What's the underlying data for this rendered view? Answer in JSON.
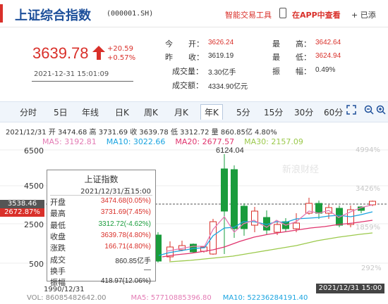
{
  "header": {
    "title": "上证综合指数",
    "code": "(000001.SH)",
    "tool_link": "智能交易工具",
    "app_link": "在APP中查看",
    "added": "+ 已添"
  },
  "quote": {
    "price": "3639.78",
    "change": "+20.59",
    "change_pct": "+0.57%",
    "datetime": "2021-12-31 15:01:09",
    "fields": [
      {
        "label": "今　　开：",
        "value": "3626.24",
        "color": "red"
      },
      {
        "label": "昨　　收：",
        "value": "3619.19",
        "color": "normal"
      },
      {
        "label": "成交量：",
        "value": "3.30亿手",
        "color": "normal"
      },
      {
        "label": "成交额：",
        "value": "4334.90亿元",
        "color": "normal"
      },
      {
        "label": "最　　高：",
        "value": "3642.64",
        "color": "red"
      },
      {
        "label": "最　　低：",
        "value": "3624.94",
        "color": "red"
      },
      {
        "label": "振　　幅：",
        "value": "0.49%",
        "color": "normal"
      }
    ]
  },
  "periods": [
    "分时",
    "5日",
    "年线",
    "日K",
    "周K",
    "月K",
    "年K",
    "5分",
    "15分",
    "30分",
    "60分"
  ],
  "active_period": "年K",
  "chart_info": {
    "line": "2021/12/31  开 3474.68 高 3731.69 收 3639.78 低 3312.72 量 860.85亿 4.80%",
    "ma5": "MA5: 3192.81",
    "ma10": "MA10: 3022.66",
    "ma20": "MA20: 2677.57",
    "ma30": "MA30: 2157.09"
  },
  "colors": {
    "up": "#d9302a",
    "down": "#1a9c3c",
    "ma5": "#e37bb4",
    "ma10": "#1aa4e0",
    "ma20": "#e0336d",
    "ma30": "#9bc94b"
  },
  "axis": {
    "y_labels": [
      "6500",
      "4500",
      "2500",
      "500"
    ],
    "right_labels": [
      "4994%",
      "3426%",
      "1859%",
      "292%"
    ],
    "current_price": "3538.46",
    "current_pct": "2672.87%",
    "start_date": "1990/12/31",
    "end_date": "2021/12/31 15:00",
    "max_label": "6124.04",
    "watermark": "新浪财经"
  },
  "tooltip": {
    "title": "上证指数",
    "date": "2021/12/31/五15:00",
    "rows": [
      {
        "label": "开盘",
        "value": "3474.68(0.05%)",
        "color": "red"
      },
      {
        "label": "最高",
        "value": "3731.69(7.45%)",
        "color": "red"
      },
      {
        "label": "最低",
        "value": "3312.72(-4.62%)",
        "color": "green"
      },
      {
        "label": "收盘",
        "value": "3639.78(4.80%)",
        "color": "red"
      },
      {
        "label": "涨跌",
        "value": "166.71(4.80%)",
        "color": "red"
      },
      {
        "label": "成交",
        "value": "860.85亿手",
        "color": "normal"
      },
      {
        "label": "换手",
        "value": "—",
        "color": "normal"
      },
      {
        "label": "振幅",
        "value": "418.97(12.06%)",
        "color": "normal"
      }
    ]
  },
  "volume": {
    "vol": "VOL: 86085482642.00",
    "ma5": "MA5: 57710885396.80",
    "ma10": "MA10: 52236284191.40"
  }
}
